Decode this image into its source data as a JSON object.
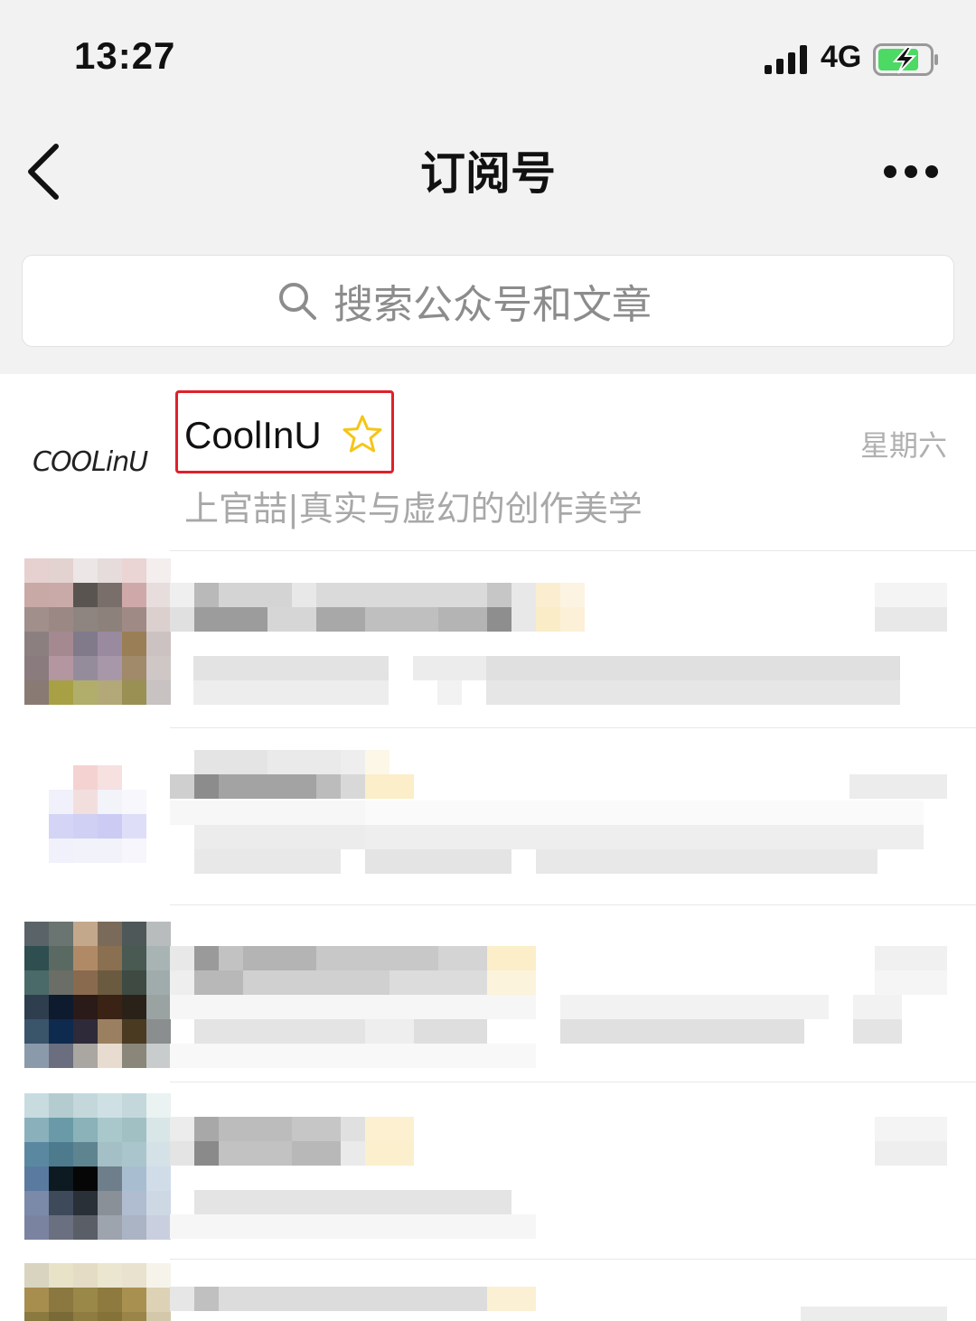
{
  "status_bar": {
    "time": "13:27",
    "network": "4G"
  },
  "nav": {
    "title": "订阅号"
  },
  "search": {
    "placeholder": "搜索公众号和文章"
  },
  "featured": {
    "logo_text": "COOLinU",
    "name": "CoolInU",
    "time": "星期六",
    "subtitle": "上官喆|真实与虚幻的创作美学"
  },
  "colors": {
    "highlight": "#e0202a",
    "star": "#f5c518",
    "battery": "#4cd964"
  }
}
